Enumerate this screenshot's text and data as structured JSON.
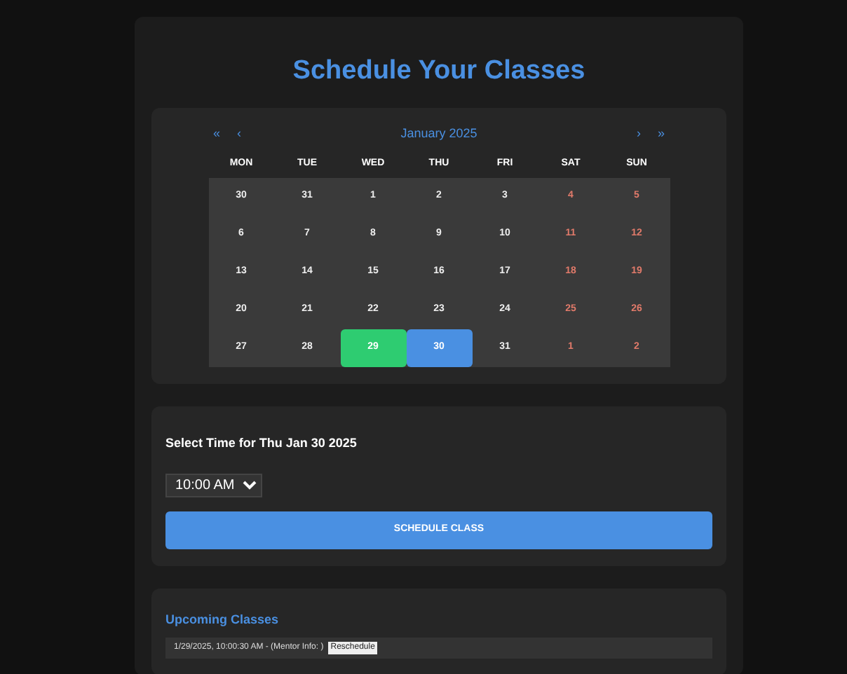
{
  "title": "Schedule Your Classes",
  "calendar": {
    "nav_prev": [
      "«",
      "‹"
    ],
    "month": "January 2025",
    "nav_next": [
      "›",
      "»"
    ],
    "weekdays": [
      "MON",
      "TUE",
      "WED",
      "THU",
      "FRI",
      "SAT",
      "SUN"
    ],
    "days": [
      {
        "text": "30",
        "weekend": false,
        "today": false,
        "selected": false
      },
      {
        "text": "31",
        "weekend": false,
        "today": false,
        "selected": false
      },
      {
        "text": "1",
        "weekend": false,
        "today": false,
        "selected": false
      },
      {
        "text": "2",
        "weekend": false,
        "today": false,
        "selected": false
      },
      {
        "text": "3",
        "weekend": false,
        "today": false,
        "selected": false
      },
      {
        "text": "4",
        "weekend": true,
        "today": false,
        "selected": false
      },
      {
        "text": "5",
        "weekend": true,
        "today": false,
        "selected": false
      },
      {
        "text": "6",
        "weekend": false,
        "today": false,
        "selected": false
      },
      {
        "text": "7",
        "weekend": false,
        "today": false,
        "selected": false
      },
      {
        "text": "8",
        "weekend": false,
        "today": false,
        "selected": false
      },
      {
        "text": "9",
        "weekend": false,
        "today": false,
        "selected": false
      },
      {
        "text": "10",
        "weekend": false,
        "today": false,
        "selected": false
      },
      {
        "text": "11",
        "weekend": true,
        "today": false,
        "selected": false
      },
      {
        "text": "12",
        "weekend": true,
        "today": false,
        "selected": false
      },
      {
        "text": "13",
        "weekend": false,
        "today": false,
        "selected": false
      },
      {
        "text": "14",
        "weekend": false,
        "today": false,
        "selected": false
      },
      {
        "text": "15",
        "weekend": false,
        "today": false,
        "selected": false
      },
      {
        "text": "16",
        "weekend": false,
        "today": false,
        "selected": false
      },
      {
        "text": "17",
        "weekend": false,
        "today": false,
        "selected": false
      },
      {
        "text": "18",
        "weekend": true,
        "today": false,
        "selected": false
      },
      {
        "text": "19",
        "weekend": true,
        "today": false,
        "selected": false
      },
      {
        "text": "20",
        "weekend": false,
        "today": false,
        "selected": false
      },
      {
        "text": "21",
        "weekend": false,
        "today": false,
        "selected": false
      },
      {
        "text": "22",
        "weekend": false,
        "today": false,
        "selected": false
      },
      {
        "text": "23",
        "weekend": false,
        "today": false,
        "selected": false
      },
      {
        "text": "24",
        "weekend": false,
        "today": false,
        "selected": false
      },
      {
        "text": "25",
        "weekend": true,
        "today": false,
        "selected": false
      },
      {
        "text": "26",
        "weekend": true,
        "today": false,
        "selected": false
      },
      {
        "text": "27",
        "weekend": false,
        "today": false,
        "selected": false
      },
      {
        "text": "28",
        "weekend": false,
        "today": false,
        "selected": false
      },
      {
        "text": "29",
        "weekend": false,
        "today": true,
        "selected": false
      },
      {
        "text": "30",
        "weekend": false,
        "today": false,
        "selected": true
      },
      {
        "text": "31",
        "weekend": false,
        "today": false,
        "selected": false
      },
      {
        "text": "1",
        "weekend": true,
        "today": false,
        "selected": false
      },
      {
        "text": "2",
        "weekend": true,
        "today": false,
        "selected": false
      }
    ]
  },
  "time_section": {
    "heading": "Select Time for Thu Jan 30 2025",
    "time_value": "10:00 AM",
    "button": "SCHEDULE CLASS"
  },
  "upcoming": {
    "heading": "Upcoming Classes",
    "items": [
      {
        "text": "1/29/2025, 10:00:30 AM - (Mentor Info: )",
        "badge": "Reschedule"
      }
    ]
  }
}
